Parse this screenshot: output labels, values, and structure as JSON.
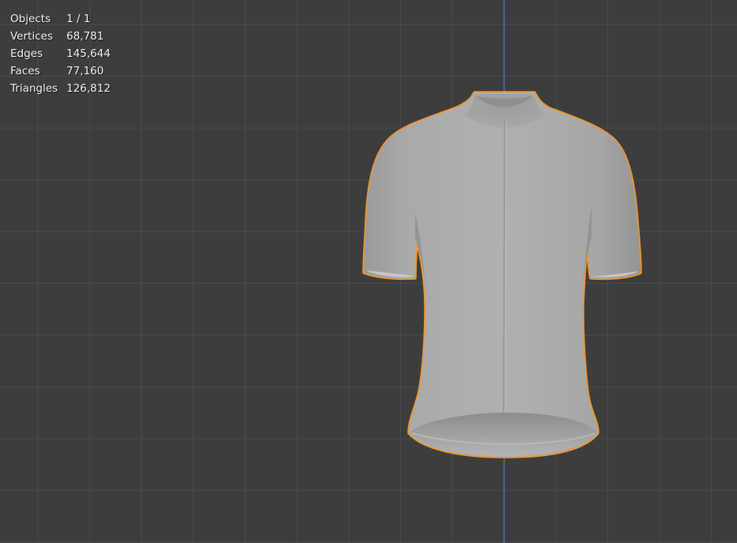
{
  "viewport": {
    "background": "#3d3d3d",
    "grid_color": "#4a4a4a",
    "axis_color": "#4a6fb5",
    "selection_outline_color": "#f0962e",
    "object_color": "#a6a6a6"
  },
  "stats": {
    "rows": [
      {
        "label": "Objects",
        "value": "1 / 1"
      },
      {
        "label": "Vertices",
        "value": "68,781"
      },
      {
        "label": "Edges",
        "value": "145,644"
      },
      {
        "label": "Faces",
        "value": "77,160"
      },
      {
        "label": "Triangles",
        "value": "126,812"
      }
    ]
  },
  "object": {
    "name_icon": "cycling-jersey-mesh-icon",
    "selected": true
  }
}
